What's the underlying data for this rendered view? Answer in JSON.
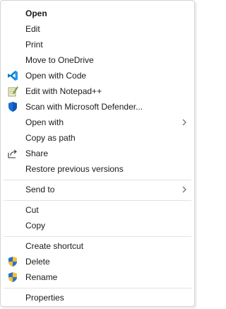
{
  "menu": {
    "items": [
      {
        "label": "Open"
      },
      {
        "label": "Edit"
      },
      {
        "label": "Print"
      },
      {
        "label": "Move to OneDrive"
      },
      {
        "label": "Open with Code",
        "icon": "vscode-icon"
      },
      {
        "label": "Edit with Notepad++",
        "icon": "notepadpp-icon"
      },
      {
        "label": "Scan with Microsoft Defender...",
        "icon": "defender-shield-icon"
      },
      {
        "label": "Open with",
        "submenu": true
      },
      {
        "label": "Copy as path"
      },
      {
        "label": "Share",
        "icon": "share-icon"
      },
      {
        "label": "Restore previous versions"
      },
      {
        "label": "Send to",
        "submenu": true
      },
      {
        "label": "Cut"
      },
      {
        "label": "Copy"
      },
      {
        "label": "Create shortcut"
      },
      {
        "label": "Delete",
        "icon": "uac-shield-icon"
      },
      {
        "label": "Rename",
        "icon": "uac-shield-icon"
      },
      {
        "label": "Properties"
      }
    ]
  },
  "colors": {
    "vscode_blue": "#0a7acc",
    "defender_blue": "#1a6ed8",
    "uac_blue": "#2b6fd6",
    "uac_yellow": "#f7c31c",
    "separator": "#e3e3e3"
  }
}
